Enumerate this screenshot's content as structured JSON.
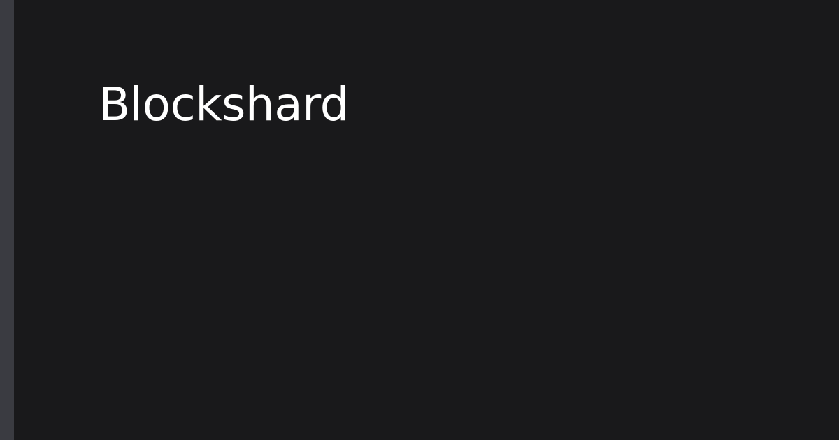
{
  "page": {
    "title": "Blockshard"
  },
  "colors": {
    "background": "#19191b",
    "accent_bar": "#3a3b41",
    "title_text": "#ffffff"
  }
}
